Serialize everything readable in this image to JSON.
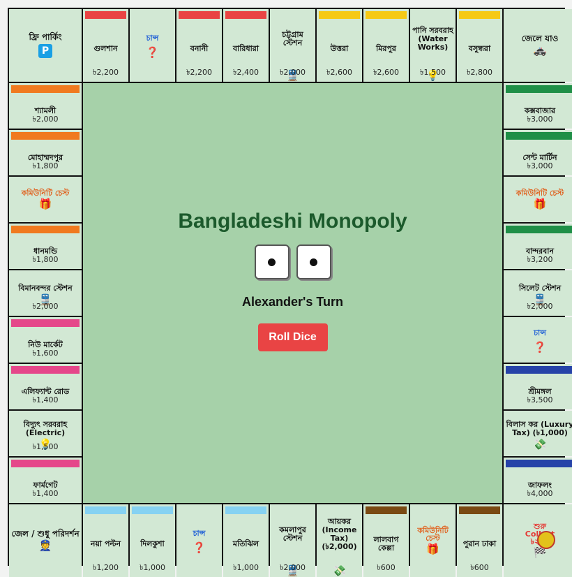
{
  "game": {
    "title": "Bangladeshi Monopoly",
    "turn_text": "Alexander's Turn",
    "roll_button": "Roll Dice",
    "dice": [
      1,
      1
    ]
  },
  "colors": {
    "red": "#e94444",
    "yellow": "#f6c915",
    "orange": "#f07a1f",
    "green": "#1f8f47",
    "pink": "#e5478a",
    "blue": "#2643a8",
    "lightblue": "#86d2f2",
    "brown": "#7a4a13"
  },
  "corners": {
    "free_parking": {
      "label": "ফ্রি পার্কিং",
      "icon": "P"
    },
    "go_to_jail": {
      "label": "জেলে যাও",
      "icon": "🚓"
    },
    "jail": {
      "label": "জেল / শুধু পরিদর্শন",
      "icon": "👮"
    },
    "go": {
      "label": "শুরু Collect ৳২০০",
      "icon": "🏁"
    }
  },
  "top": [
    {
      "name": "গুলশান",
      "price": "৳2,200",
      "color": "red"
    },
    {
      "type": "chance",
      "name": "চান্স",
      "icon": "❓"
    },
    {
      "name": "বনানী",
      "price": "৳2,200",
      "color": "red"
    },
    {
      "name": "বারিধারা",
      "price": "৳2,400",
      "color": "red"
    },
    {
      "type": "station",
      "name": "চট্টগ্রাম স্টেশন",
      "icon": "🚆",
      "price": "৳2,000"
    },
    {
      "name": "উত্তরা",
      "price": "৳2,600",
      "color": "yellow"
    },
    {
      "name": "মিরপুর",
      "price": "৳2,600",
      "color": "yellow"
    },
    {
      "type": "utility",
      "name": "পানি সরবরাহ (Water Works)",
      "icon": "💡",
      "price": "৳1,500"
    },
    {
      "name": "বসুন্ধরা",
      "price": "৳2,800",
      "color": "yellow"
    }
  ],
  "left": [
    {
      "name": "শ্যামলী",
      "price": "৳2,000",
      "color": "orange"
    },
    {
      "name": "মোহাম্মদপুর",
      "price": "৳1,800",
      "color": "orange"
    },
    {
      "type": "chest",
      "name": "কমিউনিটি চেস্ট",
      "icon": "🎁"
    },
    {
      "name": "ধানমন্ডি",
      "price": "৳1,800",
      "color": "orange"
    },
    {
      "type": "station",
      "name": "বিমানবন্দর স্টেশন",
      "icon": "🚆",
      "price": "৳2,000"
    },
    {
      "name": "নিউ মার্কেট",
      "price": "৳1,600",
      "color": "pink"
    },
    {
      "name": "এলিফ্যান্ট রোড",
      "price": "৳1,400",
      "color": "pink"
    },
    {
      "type": "utility",
      "name": "বিদ্যুৎ সরবরাহ (Electric)",
      "icon": "💡",
      "price": "৳1,500"
    },
    {
      "name": "ফার্মগেট",
      "price": "৳1,400",
      "color": "pink"
    }
  ],
  "right": [
    {
      "name": "কক্সবাজার",
      "price": "৳3,000",
      "color": "green"
    },
    {
      "name": "সেন্ট মার্টিন",
      "price": "৳3,000",
      "color": "green"
    },
    {
      "type": "chest",
      "name": "কমিউনিটি চেস্ট",
      "icon": "🎁"
    },
    {
      "name": "বান্দরবান",
      "price": "৳3,200",
      "color": "green"
    },
    {
      "type": "station",
      "name": "সিলেট স্টেশন",
      "icon": "🚆",
      "price": "৳2,000"
    },
    {
      "type": "chance",
      "name": "চান্স",
      "icon": "❓"
    },
    {
      "name": "শ্রীমঙ্গল",
      "price": "৳3,500",
      "color": "blue"
    },
    {
      "type": "tax",
      "name": "বিলাস কর (Luxury Tax) (৳1,000)",
      "icon": "💸"
    },
    {
      "name": "জাফলং",
      "price": "৳4,000",
      "color": "blue"
    }
  ],
  "bottom": [
    {
      "name": "নয়া পল্টন",
      "price": "৳1,200",
      "color": "lightblue"
    },
    {
      "name": "দিলকুশা",
      "price": "৳1,000",
      "color": "lightblue"
    },
    {
      "type": "chance",
      "name": "চান্স",
      "icon": "❓"
    },
    {
      "name": "মতিঝিল",
      "price": "৳1,000",
      "color": "lightblue"
    },
    {
      "type": "station",
      "name": "কমলাপুর স্টেশন",
      "icon": "🚆",
      "price": "৳2,000"
    },
    {
      "type": "tax",
      "name": "আয়কর (Income Tax) (৳2,000)",
      "icon": "💸"
    },
    {
      "name": "লালবাগ কেল্লা",
      "price": "৳600",
      "color": "brown"
    },
    {
      "type": "chest",
      "name": "কমিউনিটি চেস্ট",
      "icon": "🎁"
    },
    {
      "name": "পুরান ঢাকা",
      "price": "৳600",
      "color": "brown"
    }
  ]
}
